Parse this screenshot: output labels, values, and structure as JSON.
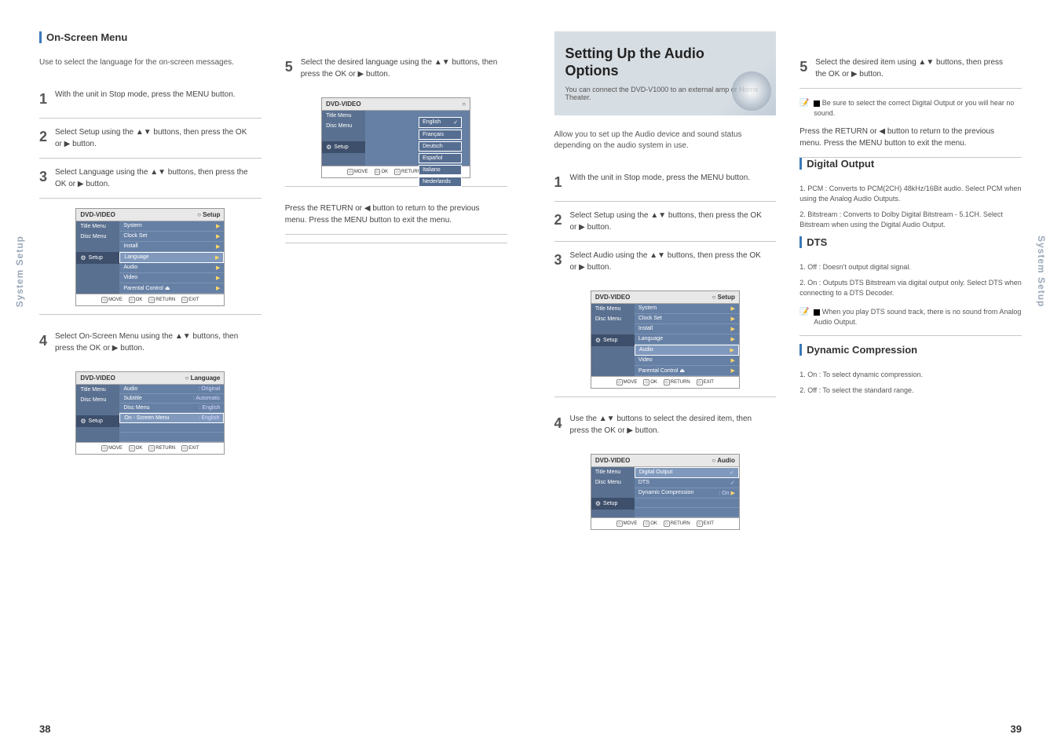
{
  "sideTab": "System Setup",
  "pageLeft": "38",
  "pageRight": "39",
  "leftPage": {
    "title": "On-Screen Menu",
    "intro": "Use to select the language for the on-screen messages.",
    "steps": [
      {
        "n": "1",
        "t": "With the unit in Stop mode, press the MENU button."
      },
      {
        "n": "2",
        "t": "Select Setup using the ▲▼ buttons, then press the OK or ▶ button."
      },
      {
        "n": "3",
        "t": "Select Language using the ▲▼ buttons, then press the OK or ▶ button."
      },
      {
        "n": "4",
        "t": "Select On-Screen Menu using the ▲▼ buttons, then press the OK or ▶ button."
      },
      {
        "n": "5",
        "t": "Select the desired language using the ▲▼ buttons, then press the OK or ▶ button."
      },
      {
        "n": "",
        "t": "Press the RETURN or ◀ button to return to the previous menu. Press the MENU button to exit the menu."
      }
    ],
    "osd1": {
      "head": "DVD-VIDEO",
      "headR": "○ Setup",
      "side": [
        "Title Menu",
        "Disc Menu",
        "",
        "Setup"
      ],
      "list": [
        "System",
        "Clock Set",
        "Install",
        "Language",
        "Audio",
        "Video",
        "Parental Control ⏏"
      ],
      "hiIndex": 3
    },
    "osd2": {
      "head": "DVD-VIDEO",
      "headR": "○ Language",
      "side": [
        "Title Menu",
        "Disc Menu",
        "",
        "Setup"
      ],
      "list": [
        {
          "k": "Audio",
          "v": ": Original"
        },
        {
          "k": "Subtitle",
          "v": ": Automatic"
        },
        {
          "k": "Disc Menu",
          "v": ": English"
        },
        {
          "k": "On - Screen Menu",
          "v": ": English"
        }
      ],
      "hiIndex": 3
    },
    "osd3": {
      "head": "DVD-VIDEO",
      "headR": "○",
      "side": [
        "Title Menu",
        "Disc Menu",
        "",
        "Setup"
      ],
      "options": [
        "English",
        "Français",
        "Deutsch",
        "Español",
        "Italiano",
        "Nederlands"
      ],
      "check": 0
    },
    "foot": [
      "MOVE",
      "OK",
      "RETURN",
      "EXIT"
    ]
  },
  "rightPage": {
    "feature": {
      "title1": "Setting Up the Audio",
      "title2": "Options",
      "sub": "You can connect the DVD-V1000 to an external amp or Home Theater."
    },
    "intro": "Allow you to set up the Audio device and sound status depending on the audio system in use.",
    "steps": [
      {
        "n": "1",
        "t": "With the unit in Stop mode, press the MENU button."
      },
      {
        "n": "2",
        "t": "Select Setup using the ▲▼ buttons, then press the OK or ▶ button."
      },
      {
        "n": "3",
        "t": "Select Audio using the ▲▼ buttons, then press the OK or ▶ button."
      },
      {
        "n": "4",
        "t": "Use the ▲▼ buttons to select the desired item, then press the OK or ▶ button."
      }
    ],
    "osd1": {
      "head": "DVD-VIDEO",
      "headR": "○ Setup",
      "side": [
        "Title Menu",
        "Disc Menu",
        "",
        "Setup"
      ],
      "list": [
        "System",
        "Clock Set",
        "Install",
        "Language",
        "Audio",
        "Video",
        "Parental Control ⏏"
      ],
      "hiIndex": 4
    },
    "osd2": {
      "head": "DVD-VIDEO",
      "headR": "○ Audio",
      "side": [
        "Title Menu",
        "Disc Menu",
        "",
        "Setup"
      ],
      "list": [
        {
          "k": "Digital Output",
          "v": "✓"
        },
        {
          "k": "DTS",
          "v": "✓"
        },
        {
          "k": "Dynamic Compression",
          "v": ": On"
        }
      ],
      "hiIndex": 0
    },
    "rightSteps": [
      {
        "n": "5",
        "t": "Select the desired item using ▲▼ buttons, then press the OK or ▶ button."
      },
      {
        "n": "",
        "t": "Press the RETURN or ◀ button to return to the previous menu. Press the MENU button to exit the menu."
      }
    ],
    "sections": {
      "digital": {
        "title": "Digital Output",
        "i1": "1. PCM : Converts to PCM(2CH) 48kHz/16Bit audio. Select PCM when using the Analog Audio Outputs.",
        "i2": "2. Bitstream : Converts to Dolby Digital Bitstream - 5.1CH. Select Bitstream when using the Digital Audio Output."
      },
      "dts": {
        "title": "DTS",
        "i1": "1. Off : Doesn't output digital signal.",
        "i2": "2. On : Outputs DTS Bitstream via digital output only. Select DTS when connecting to a DTS Decoder."
      },
      "dyn": {
        "title": "Dynamic Compression",
        "i1": "1. On : To select dynamic compression.",
        "i2": "2. Off : To select the standard range."
      }
    },
    "notes": {
      "n1": "Be sure to select the correct Digital Output or you will hear no sound.",
      "n2": "When you play DTS sound track, there is no sound from Analog Audio Output."
    }
  }
}
